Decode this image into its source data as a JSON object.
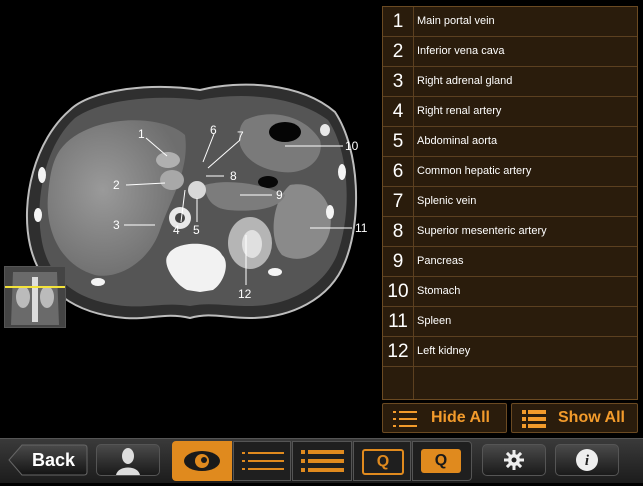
{
  "structures": [
    {
      "num": "1",
      "name": "Main portal vein"
    },
    {
      "num": "2",
      "name": "Inferior vena cava"
    },
    {
      "num": "3",
      "name": "Right adrenal gland"
    },
    {
      "num": "4",
      "name": "Right renal artery"
    },
    {
      "num": "5",
      "name": "Abdominal aorta"
    },
    {
      "num": "6",
      "name": "Common hepatic artery"
    },
    {
      "num": "7",
      "name": "Splenic vein"
    },
    {
      "num": "8",
      "name": "Superior mesenteric artery"
    },
    {
      "num": "9",
      "name": "Pancreas"
    },
    {
      "num": "10",
      "name": "Stomach"
    },
    {
      "num": "11",
      "name": "Spleen"
    },
    {
      "num": "12",
      "name": "Left kidney"
    }
  ],
  "image_labels": [
    "1",
    "2",
    "3",
    "4",
    "5",
    "6",
    "7",
    "8",
    "9",
    "10",
    "11",
    "12"
  ],
  "buttons": {
    "hide_all": "Hide All",
    "show_all": "Show All",
    "back": "Back",
    "quiz_a": "Q",
    "quiz_b": "Q"
  },
  "colors": {
    "accent": "#f39b2b",
    "list_bg": "#2a1c0c",
    "list_border": "#6b4a22"
  }
}
